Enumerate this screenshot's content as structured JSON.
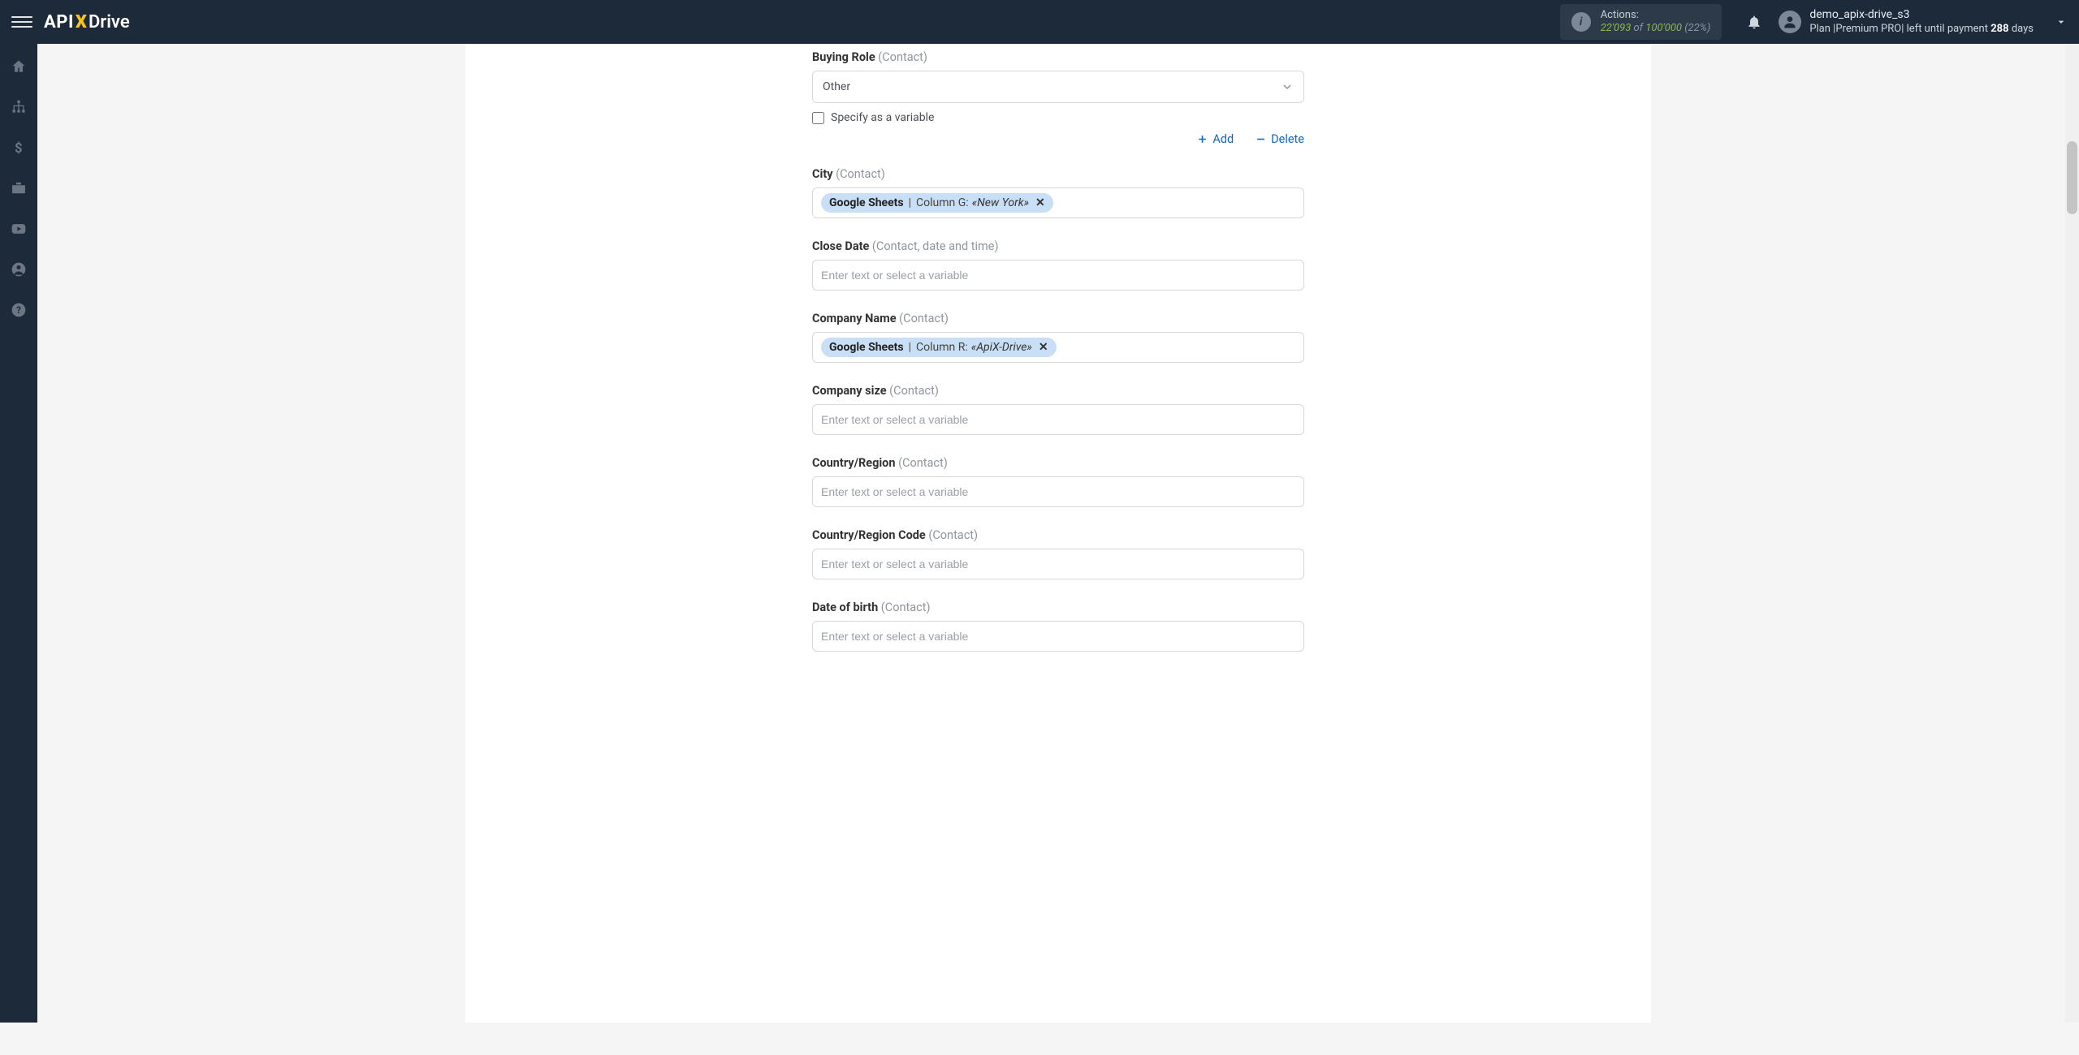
{
  "header": {
    "logo": {
      "part1": "API",
      "part2": "X",
      "part3": "Drive"
    },
    "actions": {
      "label": "Actions:",
      "current": "22'093",
      "of": " of ",
      "total": "100'000",
      "percent": " (22%)"
    },
    "user": {
      "name": "demo_apix-drive_s3",
      "plan_prefix": "Plan |",
      "plan_name": "Premium PRO",
      "plan_mid": "| left until payment ",
      "days_count": "288",
      "days_suffix": " days"
    }
  },
  "fields": {
    "buying_role": {
      "label": "Buying Role",
      "sub": "(Contact)",
      "value": "Other",
      "checkbox_label": "Specify as a variable"
    },
    "add_label": "Add",
    "delete_label": "Delete",
    "city": {
      "label": "City",
      "sub": "(Contact)",
      "tag_source": "Google Sheets",
      "tag_column": "Column G: ",
      "tag_value": "«New York»"
    },
    "close_date": {
      "label": "Close Date",
      "sub": "(Contact, date and time)",
      "placeholder": "Enter text or select a variable"
    },
    "company_name": {
      "label": "Company Name",
      "sub": "(Contact)",
      "tag_source": "Google Sheets",
      "tag_column": "Column R: ",
      "tag_value": "«ApiX-Drive»"
    },
    "company_size": {
      "label": "Company size",
      "sub": "(Contact)",
      "placeholder": "Enter text or select a variable"
    },
    "country_region": {
      "label": "Country/Region",
      "sub": "(Contact)",
      "placeholder": "Enter text or select a variable"
    },
    "country_region_code": {
      "label": "Country/Region Code",
      "sub": "(Contact)",
      "placeholder": "Enter text or select a variable"
    },
    "date_of_birth": {
      "label": "Date of birth",
      "sub": "(Contact)",
      "placeholder": "Enter text or select a variable"
    }
  }
}
